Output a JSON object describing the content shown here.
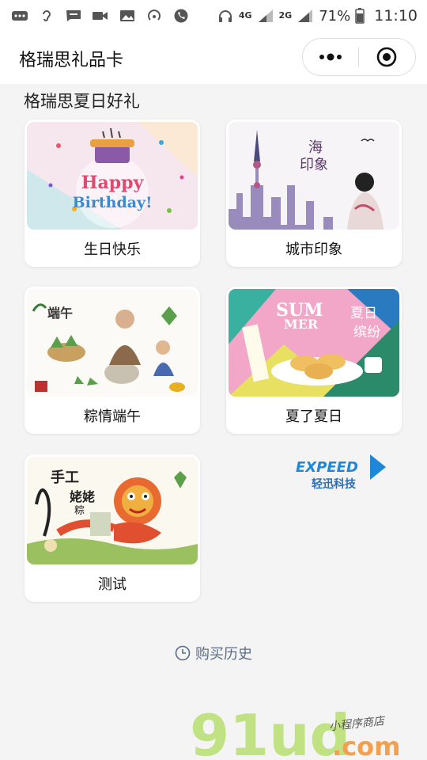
{
  "status_bar": {
    "network_1": "4G",
    "network_2": "2G",
    "battery": "71%",
    "time": "11:10"
  },
  "header": {
    "title": "格瑞思礼品卡"
  },
  "section": {
    "title": "格瑞思夏日好礼"
  },
  "cards": [
    {
      "label": "生日快乐",
      "image_text_1": "Happy",
      "image_text_2": "Birthday!"
    },
    {
      "label": "城市印象",
      "image_text_1": "海",
      "image_text_2": "印象"
    },
    {
      "label": "粽情端午",
      "image_text_1": "端午"
    },
    {
      "label": "夏了夏日",
      "image_text_1": "SUM",
      "image_text_2": "MER",
      "image_text_3": "夏日",
      "image_text_4": "缤纷"
    },
    {
      "label": "测试",
      "image_text_1": "手工",
      "image_text_2": "姥姥",
      "image_text_3": "粽"
    }
  ],
  "brand_logo": {
    "text_top": "EXPEED",
    "text_bottom": "轻迅科技"
  },
  "footer": {
    "history_label": "购买历史"
  },
  "watermark": {
    "main": "91ud",
    "suffix": ".com",
    "tagline": "小程序商店"
  },
  "colors": {
    "accent_text": "#5b6c86",
    "card_bg": "#ffffff",
    "page_bg": "#f4f4f4"
  }
}
